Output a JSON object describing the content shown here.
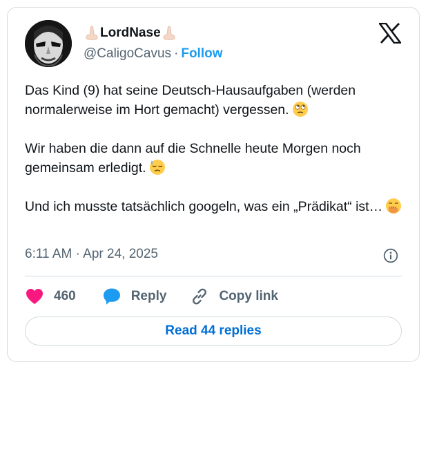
{
  "author": {
    "name_prefix_glyph": "‎",
    "name": "LordNase",
    "name_suffix_glyph": "‎",
    "handle": "@CaligoCavus",
    "separator": "·",
    "follow_label": "Follow"
  },
  "tweet": {
    "paragraph1": "Das Kind (9) hat seine Deutsch-Hausaufgaben (werden normalerweise im Hort gemacht) vergessen.",
    "paragraph2": "Wir haben die dann auf die Schnelle heute Morgen noch gemeinsam erledigt.",
    "paragraph3": "Und ich musste tatsächlich googeln, was ein „Prädikat“ ist…",
    "emoji1": "face-with-rolling-eyes",
    "emoji2": "downcast-face-with-sweat",
    "emoji3": "face-with-hand-over-mouth"
  },
  "meta": {
    "time": "6:11 AM",
    "separator": "·",
    "date": "Apr 24, 2025"
  },
  "actions": {
    "like_count": "460",
    "reply_label": "Reply",
    "copy_label": "Copy link"
  },
  "read_replies_label": "Read 44 replies",
  "icons": {
    "brand": "x-logo-icon",
    "info": "info-icon",
    "like": "heart-icon",
    "reply": "speech-bubble-icon",
    "copy": "link-icon"
  },
  "colors": {
    "like": "#f91880",
    "reply": "#1d9bf0",
    "follow": "#1d9bf0",
    "read_replies": "#006fd6",
    "muted": "#536471",
    "border": "#cfd9de"
  }
}
